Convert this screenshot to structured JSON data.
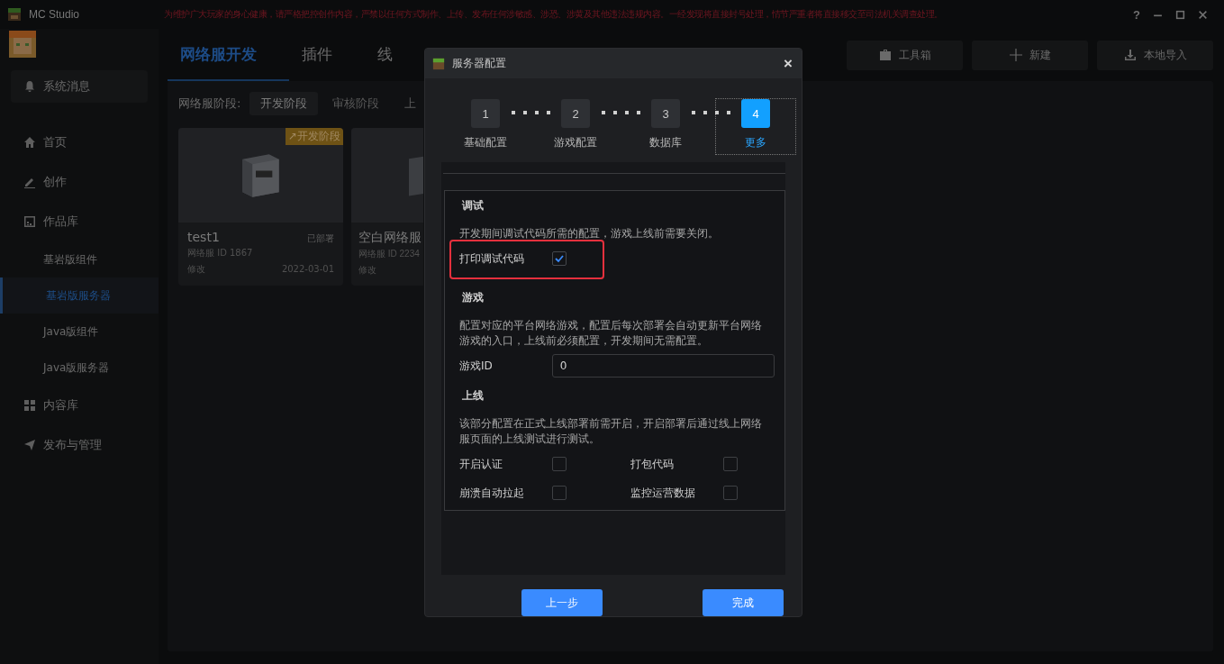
{
  "window": {
    "title": "MC Studio",
    "notice": "为维护广大玩家的身心健康，请严格把控创作内容，严禁以任何方式制作、上传、发布任何涉敏感、涉恐、涉黄及其他违法违规内容。一经发现将直接封号处理，情节严重者将直接移交至司法机关调查处理。",
    "help": "?"
  },
  "sidebar": {
    "notice_button": "系统消息",
    "items": [
      {
        "label": "首页",
        "selected": false
      },
      {
        "label": "创作",
        "selected": false
      },
      {
        "label": "作品库",
        "selected": false,
        "children": [
          {
            "label": "基岩版组件",
            "selected": false
          },
          {
            "label": "基岩版服务器",
            "selected": true
          },
          {
            "label": "Java版组件",
            "selected": false
          },
          {
            "label": "Java版服务器",
            "selected": false
          }
        ]
      },
      {
        "label": "内容库",
        "selected": false
      },
      {
        "label": "发布与管理",
        "selected": false
      }
    ]
  },
  "tabs": [
    {
      "label": "网络服开发",
      "selected": true
    },
    {
      "label": "插件",
      "selected": false
    },
    {
      "label": "线",
      "selected": false
    }
  ],
  "toolbar": [
    {
      "label": "工具箱"
    },
    {
      "label": "新建"
    },
    {
      "label": "本地导入"
    }
  ],
  "stage_filter": {
    "label": "网络服阶段:",
    "options": [
      {
        "label": "开发阶段",
        "selected": true
      },
      {
        "label": "审核阶段",
        "selected": false
      },
      {
        "label": "上",
        "selected": false
      }
    ]
  },
  "cards": [
    {
      "name": "test1",
      "badge": "↗开发阶段",
      "status": "已部署",
      "server_id": "网络服 ID 1867",
      "action": "修改",
      "date": "2022-03-01"
    },
    {
      "name": "空白网络服",
      "server_id": "网络服 ID 2234",
      "action": "修改"
    }
  ],
  "dialog": {
    "title": "服务器配置",
    "close": "×",
    "steps": [
      {
        "number": "1",
        "label": "基础配置",
        "selected": false
      },
      {
        "number": "2",
        "label": "游戏配置",
        "selected": false
      },
      {
        "number": "3",
        "label": "数据库",
        "selected": false
      },
      {
        "number": "4",
        "label": "更多",
        "selected": true
      }
    ],
    "sections": [
      {
        "title": "调试",
        "description": "开发期间调试代码所需的配置，游戏上线前需要关闭。",
        "items": [
          {
            "kind": "checkbox",
            "label": "打印调试代码",
            "checked": true,
            "highlighted": true
          }
        ]
      },
      {
        "title": "游戏",
        "description": "配置对应的平台网络游戏，配置后每次部署会自动更新平台网络游戏的入口，上线前必须配置，开发期间无需配置。",
        "items": [
          {
            "kind": "input",
            "label": "游戏ID",
            "value": "0"
          }
        ]
      },
      {
        "title": "上线",
        "description": "该部分配置在正式上线部署前需开启，开启部署后通过线上网络服页面的上线测试进行测试。",
        "items": [
          {
            "kind": "checkbox",
            "label": "开启认证",
            "checked": false,
            "highlighted": false
          },
          {
            "kind": "checkbox",
            "label": "打包代码",
            "checked": false,
            "highlighted": false
          },
          {
            "kind": "checkbox",
            "label": "崩溃自动拉起",
            "checked": false,
            "highlighted": false
          },
          {
            "kind": "checkbox",
            "label": "监控运营数据",
            "checked": false,
            "highlighted": false
          }
        ]
      }
    ],
    "buttons": [
      {
        "label": "上一步"
      },
      {
        "label": "完成"
      }
    ]
  }
}
